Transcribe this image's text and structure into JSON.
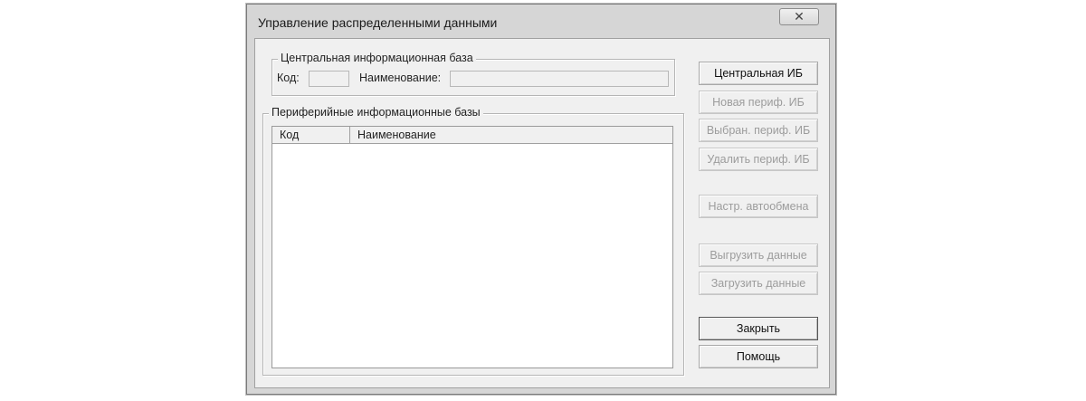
{
  "window": {
    "title": "Управление распределенными данными",
    "close_glyph": "✕"
  },
  "central_group": {
    "legend": "Центральная информационная база",
    "code_label": "Код:",
    "code_value": "",
    "name_label": "Наименование:",
    "name_value": ""
  },
  "peripheral_group": {
    "legend": "Периферийные информационные базы",
    "columns": [
      "Код",
      "Наименование"
    ],
    "rows": []
  },
  "buttons": {
    "central_ib": "Центральная ИБ",
    "new_periph": "Новая периф. ИБ",
    "selected_periph": "Выбран. периф. ИБ",
    "delete_periph": "Удалить периф. ИБ",
    "auto_exchange": "Настр. автообмена",
    "upload_data": "Выгрузить данные",
    "load_data": "Загрузить данные",
    "close": "Закрыть",
    "help": "Помощь"
  },
  "colors": {
    "window_frame": "#d6d6d6",
    "dialog_background": "#f0f0f0",
    "disabled_text": "#9c9c9c"
  }
}
